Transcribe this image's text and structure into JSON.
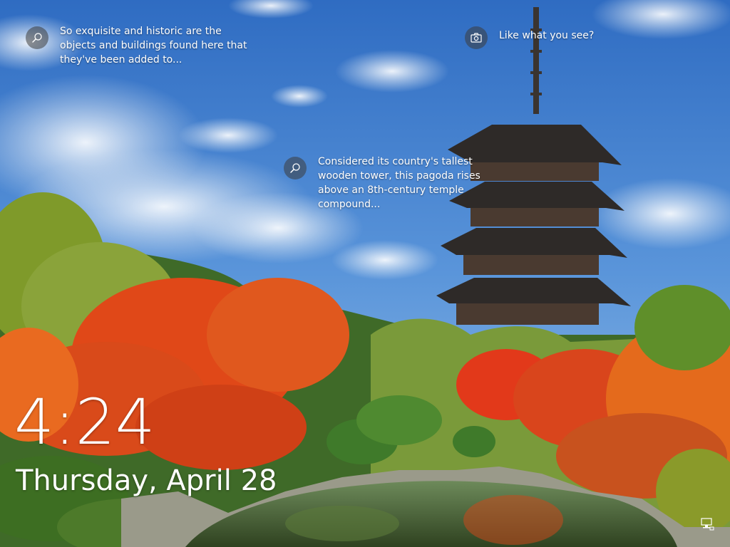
{
  "lock_screen": {
    "hotspots": [
      {
        "icon": "search-icon",
        "text": "So exquisite and historic are the objects and buildings found here that they've been added to..."
      },
      {
        "icon": "camera-icon",
        "text": "Like what you see?"
      },
      {
        "icon": "search-icon",
        "text": "Considered its country's tallest wooden tower, this pagoda rises above an 8th-century temple compound..."
      }
    ],
    "time": "4:24",
    "date": "Thursday, April 28",
    "status_icons": [
      "network-icon"
    ]
  },
  "colors": {
    "sky": "#3f7fd0",
    "foliage_red": "#e2471a",
    "foliage_orange": "#f08a1c",
    "foliage_green": "#5c8f2a",
    "pagoda": "#3a3430",
    "water": "#42582f",
    "text": "#ffffff"
  }
}
